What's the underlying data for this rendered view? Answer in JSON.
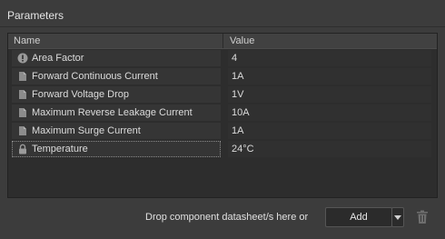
{
  "section": {
    "title": "Parameters"
  },
  "grid": {
    "columns": [
      "Name",
      "Value"
    ],
    "rows": [
      {
        "icon": "warning-circle-icon",
        "name": "Area Factor",
        "value": "4"
      },
      {
        "icon": "document-icon",
        "name": "Forward Continuous Current",
        "value": "1A"
      },
      {
        "icon": "document-icon",
        "name": "Forward Voltage Drop",
        "value": "1V"
      },
      {
        "icon": "document-icon",
        "name": "Maximum Reverse Leakage Current",
        "value": "10A"
      },
      {
        "icon": "document-icon",
        "name": "Maximum Surge Current",
        "value": "1A"
      },
      {
        "icon": "lock-icon",
        "name": "Temperature",
        "value": "24°C"
      }
    ]
  },
  "footer": {
    "drop_text": "Drop component datasheet/s here or",
    "add_label": "Add",
    "dropdown_icon": "chevron-down-icon",
    "delete_icon": "trash-icon"
  }
}
